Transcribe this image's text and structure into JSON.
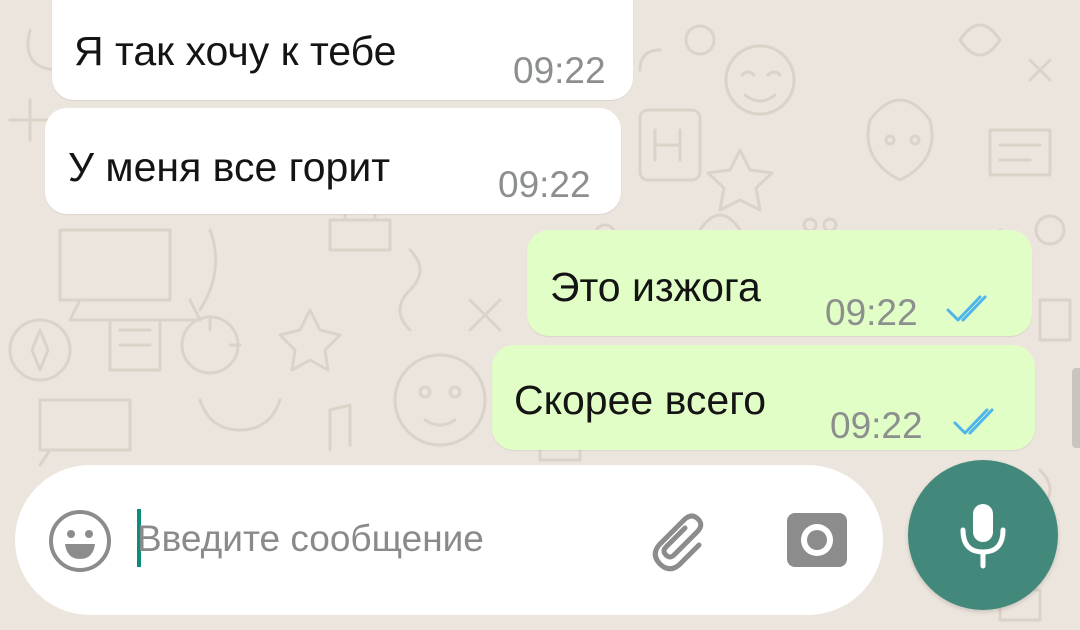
{
  "messages": [
    {
      "direction": "incoming",
      "text": "Я так хочу к тебе",
      "time": "09:22"
    },
    {
      "direction": "incoming",
      "text": "У меня все горит",
      "time": "09:22"
    },
    {
      "direction": "outgoing",
      "text": "Это изжога",
      "time": "09:22",
      "status": "read"
    },
    {
      "direction": "outgoing",
      "text": "Скорее всего",
      "time": "09:22",
      "status": "read"
    }
  ],
  "composer": {
    "placeholder": "Введите сообщение",
    "value": "",
    "emoji_icon": "emoji-icon",
    "attach_icon": "paperclip-icon",
    "camera_icon": "camera-icon",
    "send_icon": "microphone-icon"
  },
  "colors": {
    "chat_background": "#ece5dd",
    "incoming_bubble": "#ffffff",
    "outgoing_bubble": "#e1fec6",
    "read_ticks": "#4fb6ec",
    "accent": "#43897b"
  }
}
